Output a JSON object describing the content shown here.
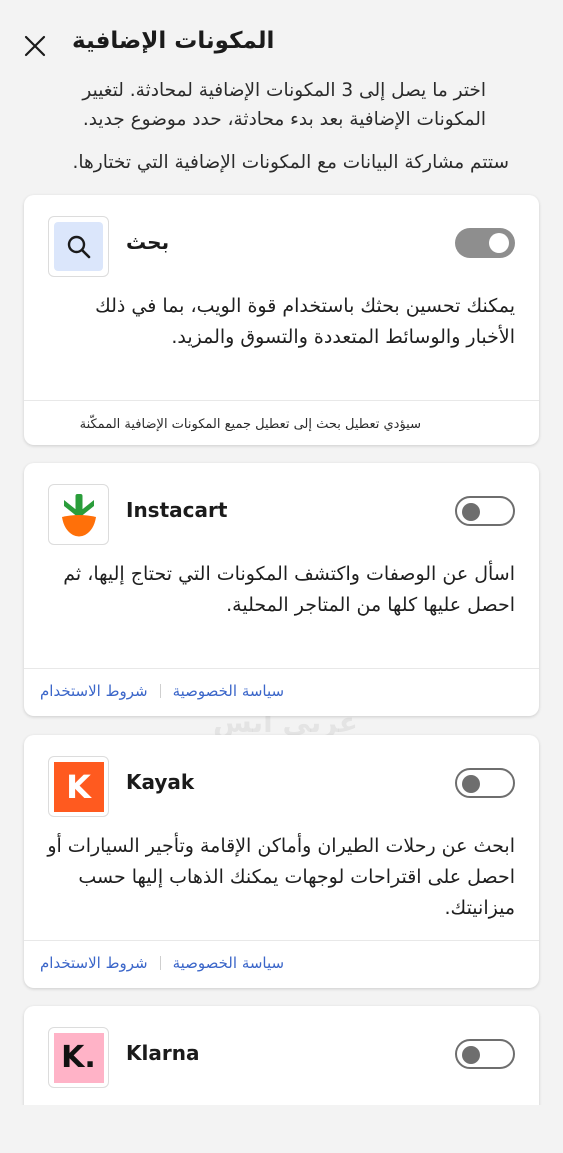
{
  "header": {
    "title": "المكونات الإضافية",
    "close_icon": "close-icon"
  },
  "intro": {
    "line1": "اختر ما يصل إلى 3 المكونات الإضافية لمحادثة. لتغيير",
    "line2": "المكونات الإضافية بعد بدء محادثة، حدد موضوع جديد.",
    "share": "ستتم مشاركة البيانات مع المكونات الإضافية التي تختارها."
  },
  "plugins": [
    {
      "name": "بحث",
      "enabled": true,
      "icon": "search-icon",
      "description": "يمكنك تحسين بحثك باستخدام قوة الويب، بما في ذلك الأخبار والوسائط المتعددة والتسوق والمزيد.",
      "note": "سيؤدي تعطيل بحث إلى تعطيل جميع المكونات الإضافية الممكّنة"
    },
    {
      "name": "Instacart",
      "enabled": false,
      "icon": "carrot-icon",
      "description": "اسأل عن الوصفات واكتشف المكونات التي تحتاج إليها، ثم احصل عليها كلها من المتاجر المحلية.",
      "privacy_label": "سياسة الخصوصية",
      "terms_label": "شروط الاستخدام"
    },
    {
      "name": "Kayak",
      "enabled": false,
      "icon": "kayak-k-icon",
      "logo_letter": "K",
      "description": "ابحث عن رحلات الطيران وأماكن الإقامة وتأجير السيارات أو احصل على اقتراحات لوجهات يمكنك الذهاب إليها حسب ميزانيتك.",
      "privacy_label": "سياسة الخصوصية",
      "terms_label": "شروط الاستخدام"
    },
    {
      "name": "Klarna",
      "enabled": false,
      "icon": "klarna-k-icon",
      "logo_letter": "K."
    }
  ],
  "watermark": {
    "text": "عربي ابس"
  },
  "colors": {
    "background": "#f3f3f3",
    "link": "#3b66c9",
    "instacart_green": "#2a9d3a",
    "instacart_orange": "#ff7009",
    "kayak_orange": "#ff5a1f",
    "klarna_pink": "#ffb3c7",
    "search_tile": "#dbe6fb"
  }
}
